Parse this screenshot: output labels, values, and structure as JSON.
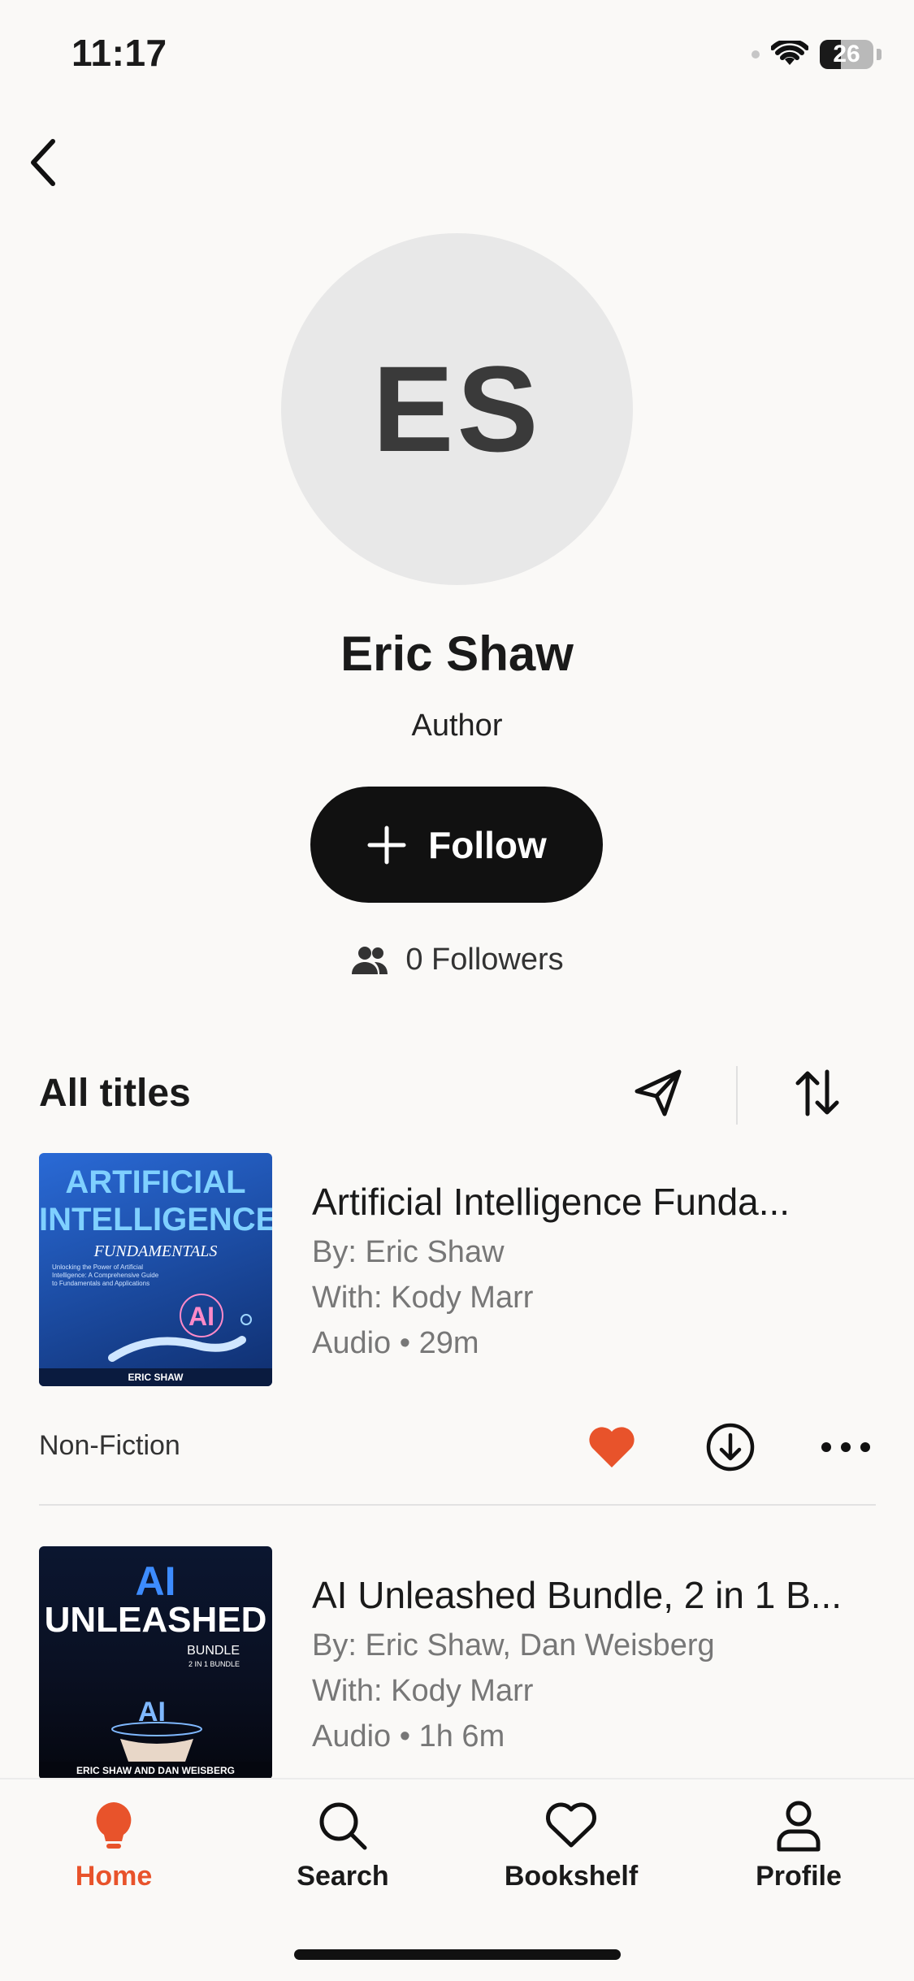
{
  "status_bar": {
    "time": "11:17",
    "battery": "26"
  },
  "profile": {
    "initials": "ES",
    "name": "Eric Shaw",
    "role": "Author",
    "follow_label": "Follow",
    "followers": "0 Followers"
  },
  "section": {
    "title": "All titles"
  },
  "books": [
    {
      "title": "Artificial Intelligence Funda...",
      "by": "By: Eric Shaw",
      "with": "With: Kody Marr",
      "format": "Audio • 29m",
      "genre": "Non-Fiction",
      "cover": {
        "line1": "ARTIFICIAL",
        "line2": "INTELLIGENCE",
        "line3": "FUNDAMENTALS",
        "small": "Unlocking the Power of Artificial Intelligence: A Comprehensive Guide to Fundamentals and Applications",
        "author": "ERIC SHAW"
      }
    },
    {
      "title": "AI Unleashed Bundle, 2 in 1 B...",
      "by": "By: Eric Shaw, Dan Weisberg",
      "with": "With: Kody Marr",
      "format": "Audio • 1h 6m",
      "cover": {
        "line1": "AI",
        "line2": "UNLEASHED",
        "line3": "BUNDLE",
        "line4": "2 IN 1 BUNDLE",
        "author": "ERIC SHAW AND DAN WEISBERG"
      }
    }
  ],
  "tabs": [
    {
      "label": "Home",
      "icon": "lightbulb-icon"
    },
    {
      "label": "Search",
      "icon": "search-icon"
    },
    {
      "label": "Bookshelf",
      "icon": "heart-icon"
    },
    {
      "label": "Profile",
      "icon": "person-icon"
    }
  ],
  "colors": {
    "accent": "#e8532b",
    "button_bg": "#111111",
    "background": "#faf9f7"
  }
}
